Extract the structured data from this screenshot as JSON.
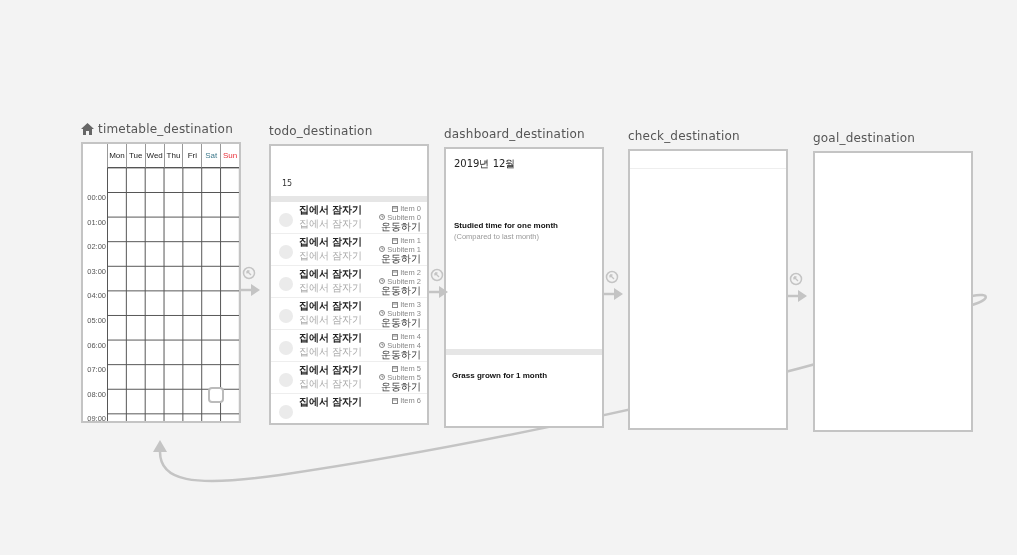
{
  "nodes": [
    {
      "kind": "timetable",
      "label": "timetable_destination",
      "start": true,
      "days": [
        {
          "label": "Mon",
          "kind": "weekday"
        },
        {
          "label": "Tue",
          "kind": "weekday"
        },
        {
          "label": "Wed",
          "kind": "weekday"
        },
        {
          "label": "Thu",
          "kind": "weekday"
        },
        {
          "label": "Fri",
          "kind": "weekday"
        },
        {
          "label": "Sat",
          "kind": "saturday"
        },
        {
          "label": "Sun",
          "kind": "sunday"
        }
      ],
      "times": [
        "00:00",
        "01:00",
        "02:00",
        "03:00",
        "04:00",
        "05:00",
        "06:00",
        "07:00",
        "08:00",
        "09:00"
      ]
    },
    {
      "kind": "todo",
      "label": "todo_destination",
      "start": false,
      "date": "15",
      "rows": [
        {
          "title": "집에서 잠자기",
          "subtitle": "집에서 잠자기",
          "item": "Item 0",
          "subitem": "Subitem 0",
          "tag": "운동하기"
        },
        {
          "title": "집에서 잠자기",
          "subtitle": "집에서 잠자기",
          "item": "Item 1",
          "subitem": "Subitem 1",
          "tag": "운동하기"
        },
        {
          "title": "집에서 잠자기",
          "subtitle": "집에서 잠자기",
          "item": "Item 2",
          "subitem": "Subitem 2",
          "tag": "운동하기"
        },
        {
          "title": "집에서 잠자기",
          "subtitle": "집에서 잠자기",
          "item": "Item 3",
          "subitem": "Subitem 3",
          "tag": "운동하기"
        },
        {
          "title": "집에서 잠자기",
          "subtitle": "집에서 잠자기",
          "item": "Item 4",
          "subitem": "Subitem 4",
          "tag": "운동하기"
        },
        {
          "title": "집에서 잠자기",
          "subtitle": "집에서 잠자기",
          "item": "Item 5",
          "subitem": "Subitem 5",
          "tag": "운동하기"
        },
        {
          "title": "집에서 잠자기",
          "item": "Item 6"
        }
      ]
    },
    {
      "kind": "dashboard",
      "label": "dashboard_destination",
      "start": false,
      "month": "2019년 12월",
      "studied_title": "Studied time for one month",
      "studied_note": "(Compared to last month)",
      "grass_title": "Grass grown for 1 month"
    },
    {
      "kind": "check",
      "label": "check_destination",
      "start": false
    },
    {
      "kind": "goal",
      "label": "goal_destination",
      "start": false
    }
  ]
}
